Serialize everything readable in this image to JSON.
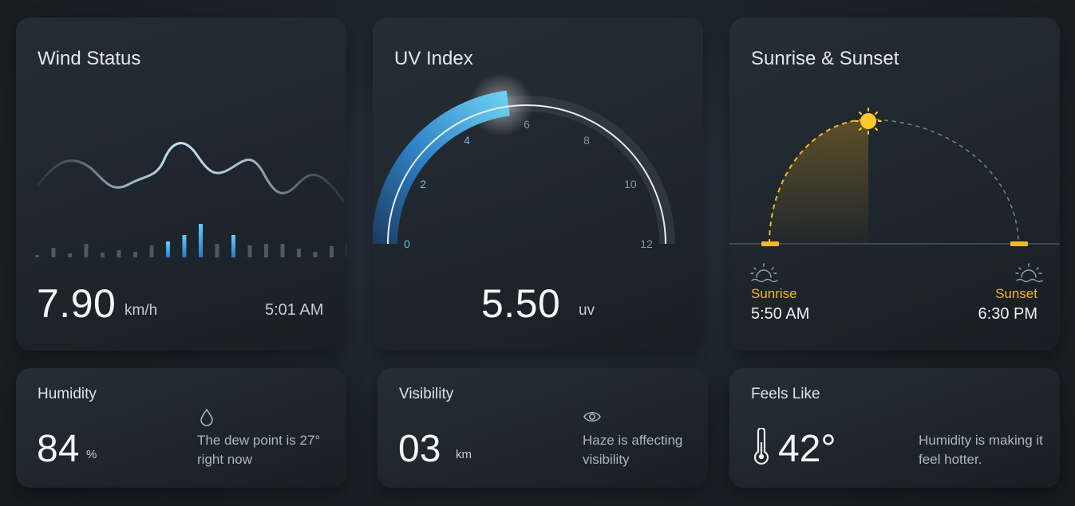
{
  "wind": {
    "title": "Wind Status",
    "value": "7.90",
    "unit": "km/h",
    "time": "5:01 AM",
    "bars": [
      0.1,
      0.6,
      0.25,
      0.85,
      0.3,
      0.45,
      0.35,
      0.75,
      1.0,
      1.4,
      2.1,
      0.85,
      1.4,
      0.75,
      0.85,
      0.85,
      0.55,
      0.35,
      0.7,
      0.85,
      0.35
    ]
  },
  "uv": {
    "title": "UV Index",
    "value": "5.50",
    "unit": "uv",
    "level": 5.5,
    "max": 12,
    "ticks": [
      "0",
      "2",
      "4",
      "6",
      "8",
      "10",
      "12"
    ]
  },
  "sun": {
    "title": "Sunrise & Sunset",
    "sunrise_label": "Sunrise",
    "sunrise_time": "5:50 AM",
    "sunset_label": "Sunset",
    "sunset_time": "6:30 PM",
    "accent": "#f2b828"
  },
  "humidity": {
    "title": "Humidity",
    "value": "84",
    "unit": "%",
    "note": "The dew point is 27° right now",
    "icon": "droplet-icon"
  },
  "visibility": {
    "title": "Visibility",
    "value": "03",
    "unit": "km",
    "note": "Haze is affecting visibility",
    "icon": "eye-icon"
  },
  "feels": {
    "title": "Feels Like",
    "value": "42°",
    "note": "Humidity is making it feel hotter.",
    "icon": "thermometer-icon"
  }
}
